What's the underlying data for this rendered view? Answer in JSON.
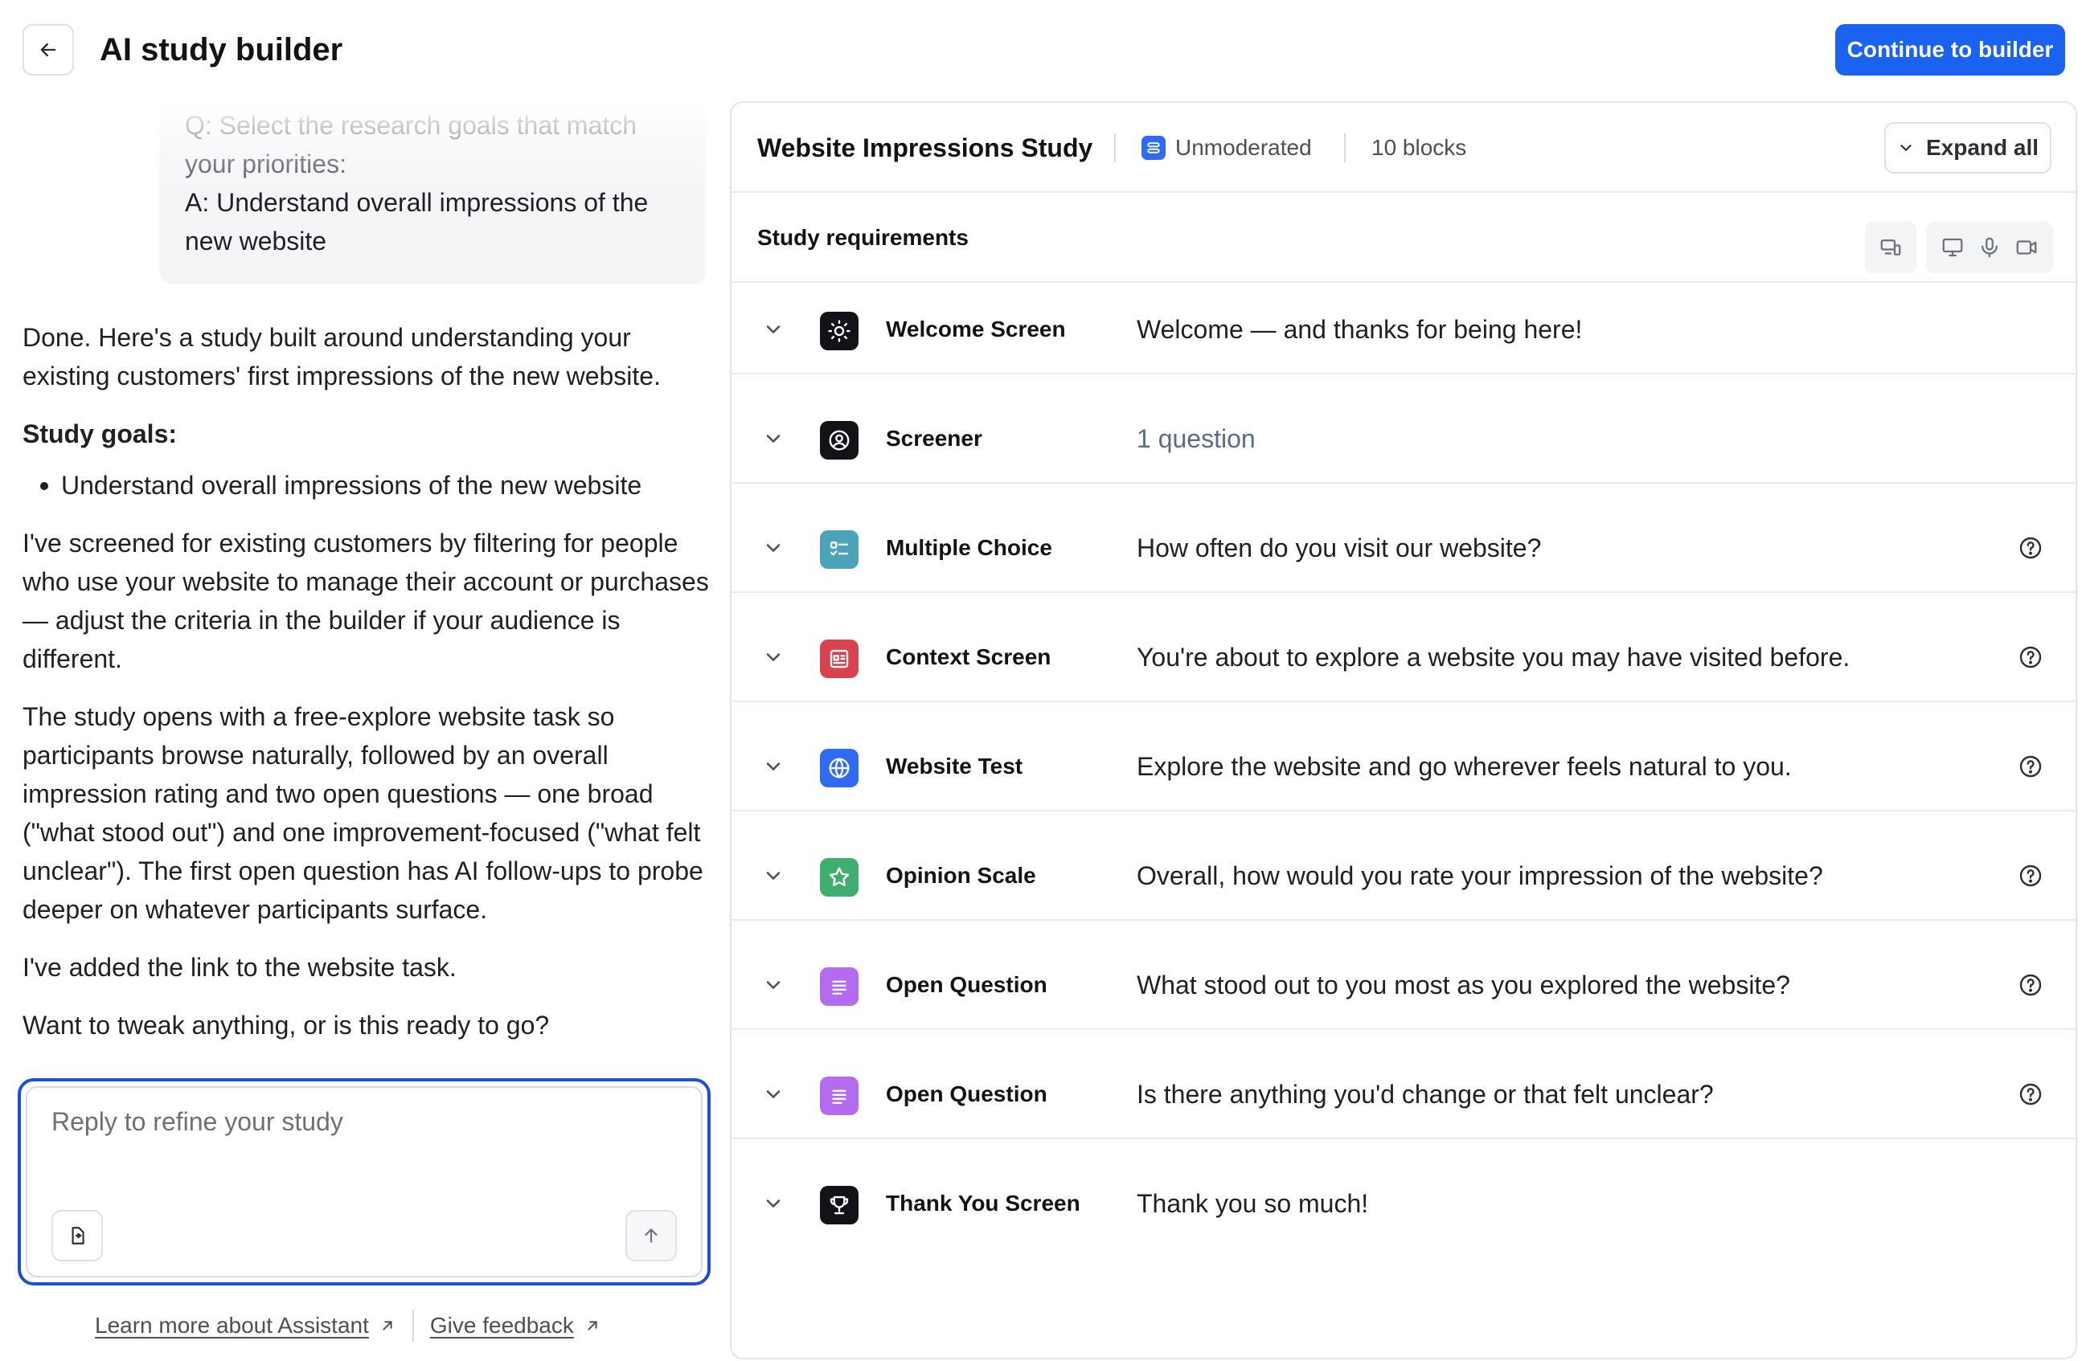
{
  "header": {
    "title": "AI study builder",
    "continue_label": "Continue to builder",
    "accent": "#1a62f0"
  },
  "chat": {
    "qa": {
      "q_lines": [
        "Q: Select the research goals that match",
        "your priorities:"
      ],
      "a_lines": [
        "A: Understand overall impressions of the",
        "new website"
      ]
    },
    "intro": "Done. Here's a study built around understanding your existing customers' first impressions of the new website.",
    "goals_title": "Study goals:",
    "goals": [
      "Understand overall impressions of the new website"
    ],
    "paragraph_screen": "I've screened for existing customers by filtering for people who use your website to manage their account or purchases — adjust the criteria in the builder if your audience is different.",
    "paragraph_flow": "The study opens with a free-explore website task so participants browse naturally, followed by an overall impression rating and two open questions — one broad (\"what stood out\") and one improvement-focused (\"what felt unclear\"). The first open question has AI follow-ups to probe deeper on whatever participants surface.",
    "paragraph_link": "I've added the link to the website task.",
    "paragraph_question": "Want to tweak anything, or is this ready to go?",
    "reply_placeholder": "Reply to refine your study"
  },
  "footer": {
    "learn_more": "Learn more about Assistant",
    "feedback": "Give feedback"
  },
  "study": {
    "title": "Website Impressions Study",
    "mode": "Unmoderated",
    "blocks_count": "10 blocks",
    "expand_label": "Expand all",
    "requirements_label": "Study requirements",
    "blocks": [
      {
        "name": "Welcome Screen",
        "text": "Welcome — and thanks for being here!",
        "icon": "sun-icon",
        "color": "#111318",
        "help": false,
        "muted": false
      },
      {
        "name": "Screener",
        "text": "1 question",
        "icon": "user-circle-icon",
        "color": "#111318",
        "help": false,
        "muted": true
      },
      {
        "name": "Multiple Choice",
        "text": "How often do you visit our website?",
        "icon": "checklist-icon",
        "color": "#4aa3b8",
        "help": true,
        "muted": false
      },
      {
        "name": "Context Screen",
        "text": "You're about to explore a website you may have visited before.",
        "icon": "context-icon",
        "color": "#d9434f",
        "help": true,
        "muted": false
      },
      {
        "name": "Website Test",
        "text": "Explore the website and go wherever feels natural to you.",
        "icon": "globe-icon",
        "color": "#2f6bf0",
        "help": true,
        "muted": false
      },
      {
        "name": "Opinion Scale",
        "text": "Overall, how would you rate your impression of the website?",
        "icon": "star-icon",
        "color": "#3fae6e",
        "help": true,
        "muted": false
      },
      {
        "name": "Open Question",
        "text": "What stood out to you most as you explored the website?",
        "icon": "lines-icon",
        "color": "#b36cf0",
        "help": true,
        "muted": false
      },
      {
        "name": "Open Question",
        "text": "Is there anything you'd change or that felt unclear?",
        "icon": "lines-icon",
        "color": "#b36cf0",
        "help": true,
        "muted": false
      },
      {
        "name": "Thank You Screen",
        "text": "Thank you so much!",
        "icon": "trophy-icon",
        "color": "#111318",
        "help": false,
        "muted": false
      }
    ]
  }
}
